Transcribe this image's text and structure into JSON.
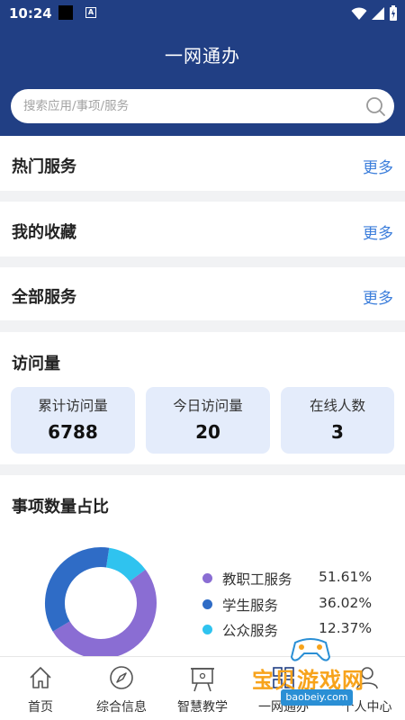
{
  "status_bar": {
    "time": "10:24",
    "a_icon": "A"
  },
  "header": {
    "title": "一网通办"
  },
  "search": {
    "placeholder": "搜索应用/事项/服务"
  },
  "sections": {
    "hot": {
      "title": "热门服务",
      "more": "更多"
    },
    "favorites": {
      "title": "我的收藏",
      "more": "更多"
    },
    "all": {
      "title": "全部服务",
      "more": "更多"
    }
  },
  "visits": {
    "title": "访问量",
    "stats": [
      {
        "label": "累计访问量",
        "value": "6788"
      },
      {
        "label": "今日访问量",
        "value": "20"
      },
      {
        "label": "在线人数",
        "value": "3"
      }
    ]
  },
  "proportion": {
    "title": "事项数量占比"
  },
  "chart_data": {
    "type": "pie",
    "categories": [
      "教职工服务",
      "学生服务",
      "公众服务"
    ],
    "values": [
      51.61,
      36.02,
      12.37
    ],
    "labels": [
      "51.61%",
      "36.02%",
      "12.37%"
    ],
    "colors": [
      "#8a6dd3",
      "#2f6cc6",
      "#2fc3ef"
    ]
  },
  "tabbar": {
    "items": [
      {
        "label": "首页",
        "icon": "home-icon"
      },
      {
        "label": "综合信息",
        "icon": "compass-icon"
      },
      {
        "label": "智慧教学",
        "icon": "easel-icon"
      },
      {
        "label": "一网通办",
        "icon": "grid-icon"
      },
      {
        "label": "个人中心",
        "icon": "person-icon"
      }
    ]
  },
  "watermark": {
    "text": "宝贝游戏网",
    "url": "baobeiy.com"
  }
}
